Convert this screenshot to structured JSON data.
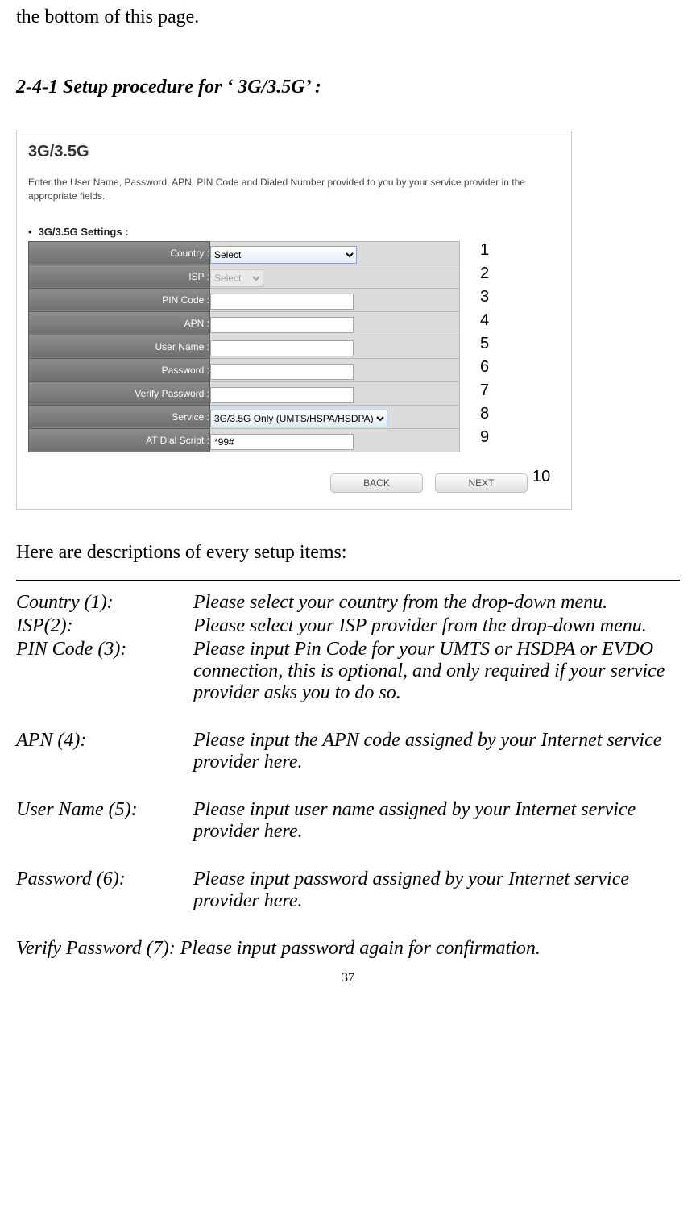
{
  "top_fragment": "the bottom of this page.",
  "section_heading": "2-4-1 Setup procedure for ‘ 3G/3.5G’ :",
  "screenshot": {
    "title": "3G/3.5G",
    "description": "Enter the User Name, Password, APN, PIN Code and Dialed Number provided to you by your service provider in the appropriate fields.",
    "subheading": "3G/3.5G Settings :",
    "rows": {
      "country": {
        "label": "Country :",
        "value": "Select"
      },
      "isp": {
        "label": "ISP :",
        "value": "Select"
      },
      "pin": {
        "label": "PIN Code :",
        "value": ""
      },
      "apn": {
        "label": "APN :",
        "value": ""
      },
      "user": {
        "label": "User Name :",
        "value": ""
      },
      "pass": {
        "label": "Password :",
        "value": ""
      },
      "verify": {
        "label": "Verify Password :",
        "value": ""
      },
      "service": {
        "label": "Service :",
        "value": "3G/3.5G Only (UMTS/HSPA/HSDPA)"
      },
      "dial": {
        "label": "AT Dial Script :",
        "value": "*99#"
      }
    },
    "buttons": {
      "back": "BACK",
      "next": "NEXT"
    },
    "callouts": [
      "1",
      "2",
      "3",
      "4",
      "5",
      "6",
      "7",
      "8",
      "9",
      "10"
    ]
  },
  "descriptions_intro": "Here are descriptions of every setup items:",
  "defs": {
    "country": {
      "term": "Country (1):",
      "desc": "Please select your country from the drop-down menu."
    },
    "isp": {
      "term": "ISP(2):",
      "desc": "Please select your ISP provider from the drop-down menu."
    },
    "pin": {
      "term": "PIN Code (3):",
      "desc": "Please input Pin Code for your UMTS or HSDPA or EVDO connection, this is optional, and only required if your service provider asks you to do so."
    },
    "apn": {
      "term": "APN (4):",
      "desc": "Please input the APN code assigned by your Internet service provider here."
    },
    "user": {
      "term": "User Name (5):",
      "desc": "Please input user name assigned by your Internet service provider here."
    },
    "pass": {
      "term": "Password (6):",
      "desc": "Please input password assigned by your Internet service provider here."
    },
    "verify": {
      "full": "Verify Password (7): Please input password again for confirmation."
    }
  },
  "page_number": "37"
}
